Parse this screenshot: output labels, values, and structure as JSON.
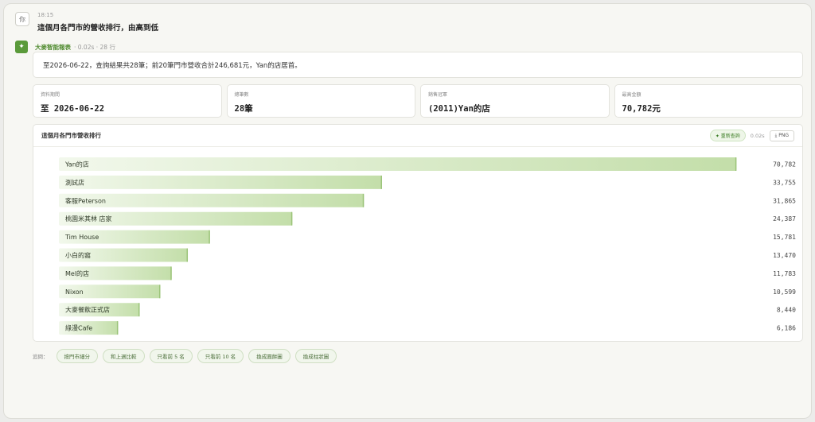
{
  "user": {
    "avatar": "你",
    "time": "18:15",
    "message": "這個月各門市的營收排行，由高到低"
  },
  "bot": {
    "avatar_icon": "spark-icon",
    "name": "大麥智能報表",
    "meta": "· 0.02s · 28 行"
  },
  "summary": "至2026-06-22，查詢結果共28筆；前20筆門市營收合計246,681元，Yan的店居首。",
  "stats": [
    {
      "label": "資料期間",
      "value": "至 2026-06-22"
    },
    {
      "label": "總筆數",
      "value": "28筆"
    },
    {
      "label": "銷售冠軍",
      "value": "(2011)Yan的店"
    },
    {
      "label": "最高金額",
      "value": "70,782元"
    }
  ],
  "chart_header": {
    "title": "這個月各門市營收排行",
    "refresh_label": "重新查詢",
    "time": "0.02s",
    "png_label": "PNG"
  },
  "chart_data": {
    "type": "bar",
    "orientation": "horizontal",
    "categories": [
      "Yan的店",
      "測試店",
      "客服Peterson",
      "桃園米其林 店家",
      "Tim House",
      "小白的窩",
      "Mel的店",
      "Nixon",
      "大麥餐飲正式店",
      "綠漫Cafe"
    ],
    "values": [
      70782,
      33755,
      31865,
      24387,
      15781,
      13470,
      11783,
      10599,
      8440,
      6186
    ],
    "value_labels": [
      "70,782",
      "33,755",
      "31,865",
      "24,387",
      "15,781",
      "13,470",
      "11,783",
      "10,599",
      "8,440",
      "6,186"
    ],
    "xlim": [
      0,
      72000
    ],
    "colors": {
      "bar_start": "#f2f8ec",
      "bar_end": "#c3dea9",
      "bar_edge": "#9cc47a"
    }
  },
  "suggestions": {
    "label": "追問：",
    "chips": [
      "按門市細分",
      "和上週比較",
      "只看前 5 名",
      "只看前 10 名",
      "換成圓餅圖",
      "換成柱狀圖"
    ]
  }
}
